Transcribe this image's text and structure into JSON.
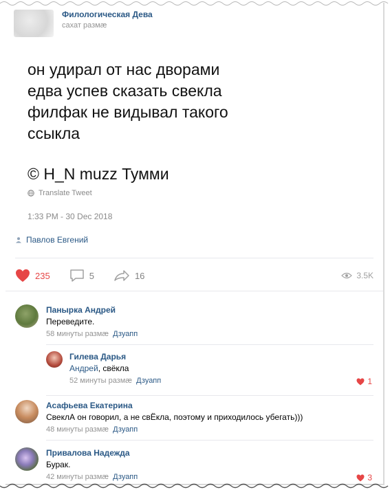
{
  "post": {
    "author": "Филологическая Дева",
    "time": "сахат размæ",
    "tweet_lines": "он удирал от нас дворами\nедва успев сказать свекла\nфилфак не видывал такого\nссыкла",
    "credit": "© H_N muzz Тумми",
    "translate": "Translate Tweet",
    "timestamp": "1:33 PM - 30 Dec 2018",
    "source": "Павлов Евгений"
  },
  "actions": {
    "likes": "235",
    "comments": "5",
    "shares": "16",
    "views": "3.5K"
  },
  "comments": [
    {
      "name": "Панырка Андрей",
      "text": "Переведите.",
      "time": "58 минуты размæ",
      "reply": "Дзуапп"
    },
    {
      "name": "Гилева Дарья",
      "mention": "Андрей",
      "text": ", свёкла",
      "time": "52 минуты размæ",
      "reply": "Дзуапп",
      "likes": "1"
    },
    {
      "name": "Асафьева Екатерина",
      "text": "СвеклА он говорил, а не свЁкла, поэтому и приходилось убегать)))",
      "time": "48 минуты размæ",
      "reply": "Дзуапп"
    },
    {
      "name": "Привалова Надежда",
      "text": "Бурак.",
      "time": "42 минуты размæ",
      "reply": "Дзуапп",
      "likes": "3"
    }
  ],
  "colors": {
    "link": "#2a5885",
    "like": "#e64646",
    "muted": "#939393"
  }
}
